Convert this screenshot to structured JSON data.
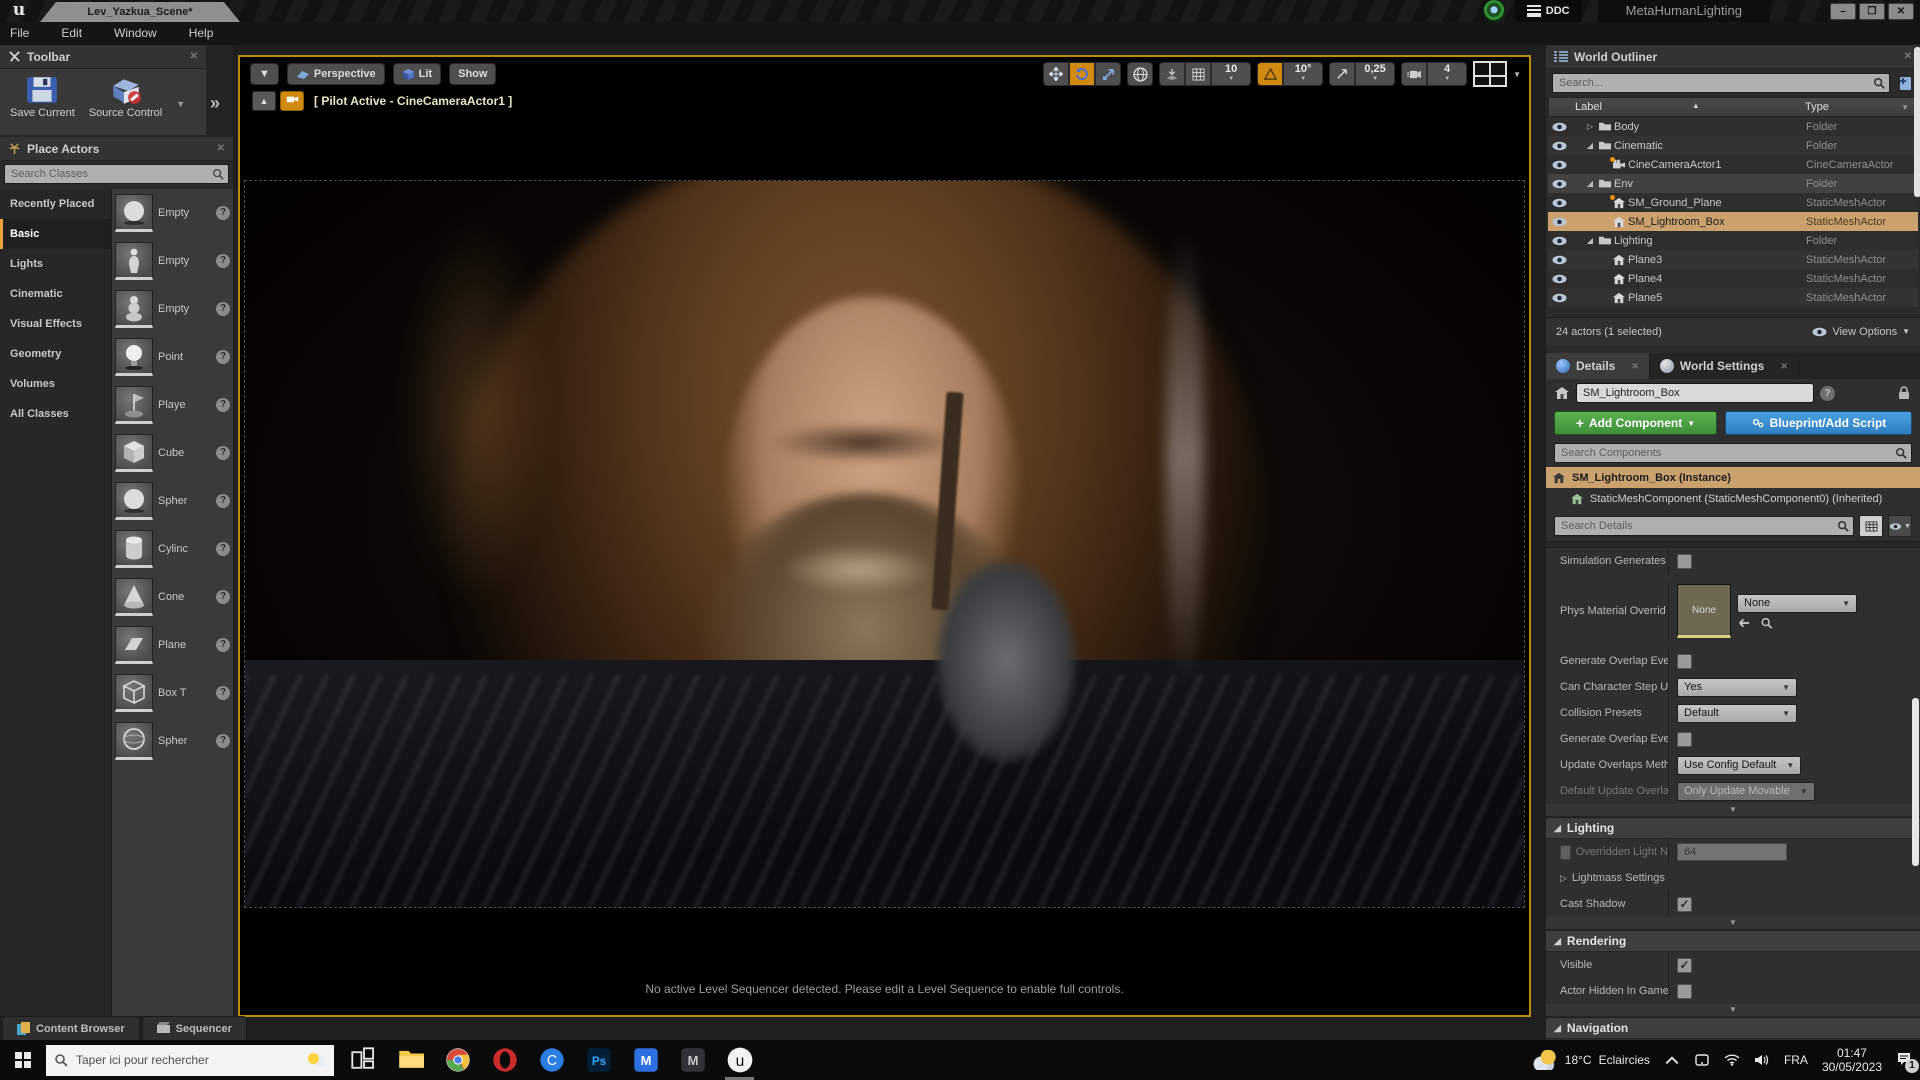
{
  "window": {
    "tab_title": "Lev_Yazkua_Scene*",
    "menu": [
      "File",
      "Edit",
      "Window",
      "Help"
    ],
    "ddc_label": "DDC",
    "session_label": "MetaHumanLighting"
  },
  "icons": {
    "help": "?",
    "sort_asc": "▲",
    "caret": "▼",
    "collapsed": "▷",
    "expanded": "◢",
    "chevrons": "»",
    "minimize": "–",
    "restore": "❐",
    "close": "✕",
    "eject": "▲"
  },
  "toolbar": {
    "title": "Toolbar",
    "save": "Save Current",
    "source": "Source Control"
  },
  "place_actors": {
    "title": "Place Actors",
    "search_placeholder": "Search Classes",
    "categories": [
      {
        "label": "Recently Placed"
      },
      {
        "label": "Basic",
        "selected": true
      },
      {
        "label": "Lights"
      },
      {
        "label": "Cinematic"
      },
      {
        "label": "Visual Effects"
      },
      {
        "label": "Geometry"
      },
      {
        "label": "Volumes"
      },
      {
        "label": "All Classes"
      }
    ],
    "items": [
      {
        "icon": "sphere",
        "label": "Empty"
      },
      {
        "icon": "character",
        "label": "Empty"
      },
      {
        "icon": "pawn",
        "label": "Empty"
      },
      {
        "icon": "point-light",
        "label": "Point"
      },
      {
        "icon": "player-start",
        "label": "Playe"
      },
      {
        "icon": "cube",
        "label": "Cube"
      },
      {
        "icon": "sphere",
        "label": "Spher"
      },
      {
        "icon": "cylinder",
        "label": "Cylinc"
      },
      {
        "icon": "cone",
        "label": "Cone"
      },
      {
        "icon": "plane",
        "label": "Plane"
      },
      {
        "icon": "box-trigger",
        "label": "Box T"
      },
      {
        "icon": "sphere-trigger",
        "label": "Spher"
      }
    ]
  },
  "viewport": {
    "perspective": "Perspective",
    "lit": "Lit",
    "show": "Show",
    "pilot": "[ Pilot Active - CineCameraActor1 ]",
    "snap_move": "10",
    "snap_rotate": "10°",
    "snap_scale": "0,25",
    "camera_speed": "4",
    "message": "No active Level Sequencer detected. Please edit a Level Sequence to enable full controls."
  },
  "outliner": {
    "title": "World Outliner",
    "search_placeholder": "Search...",
    "col_label": "Label",
    "col_type": "Type",
    "rows": [
      {
        "indent": 1,
        "exp": "collapsed",
        "icon": "folder",
        "label": "Body",
        "type": "Folder"
      },
      {
        "indent": 1,
        "exp": "expanded",
        "icon": "folder",
        "label": "Cinematic",
        "type": "Folder"
      },
      {
        "indent": 2,
        "icon": "cine-camera",
        "label": "CineCameraActor1",
        "type": "CineCameraActor",
        "dot": true
      },
      {
        "indent": 1,
        "exp": "expanded",
        "icon": "folder",
        "label": "Env",
        "type": "Folder",
        "hover": true
      },
      {
        "indent": 2,
        "icon": "static-mesh",
        "label": "SM_Ground_Plane",
        "type": "StaticMeshActor",
        "dot": true
      },
      {
        "indent": 2,
        "icon": "static-mesh",
        "label": "SM_Lightroom_Box",
        "type": "StaticMeshActor",
        "selected": true
      },
      {
        "indent": 1,
        "exp": "expanded",
        "icon": "folder",
        "label": "Lighting",
        "type": "Folder"
      },
      {
        "indent": 2,
        "icon": "static-mesh",
        "label": "Plane3",
        "type": "StaticMeshActor"
      },
      {
        "indent": 2,
        "icon": "static-mesh",
        "label": "Plane4",
        "type": "StaticMeshActor"
      },
      {
        "indent": 2,
        "icon": "static-mesh",
        "label": "Plane5",
        "type": "StaticMeshActor"
      }
    ],
    "footer": "24 actors (1 selected)",
    "view_options": "View Options"
  },
  "details": {
    "tab_details": "Details",
    "tab_world": "World Settings",
    "name_value": "SM_Lightroom_Box",
    "add_component": "Add Component",
    "blueprint": "Blueprint/Add Script",
    "search_components": "Search Components",
    "components": [
      "SM_Lightroom_Box (Instance)",
      "StaticMeshComponent (StaticMeshComponent0) (Inherited)"
    ],
    "search_details": "Search Details",
    "rows": [
      {
        "label": "Simulation Generates",
        "control": "checkbox",
        "checked": false
      },
      {
        "label": "Phys Material Overrid",
        "control": "asset",
        "value": "None"
      },
      {
        "label": "Generate Overlap Eve",
        "control": "checkbox",
        "checked": false
      },
      {
        "label": "Can Character Step U",
        "control": "dropdown",
        "value": "Yes"
      },
      {
        "label": "Collision Presets",
        "control": "dropdown",
        "value": "Default"
      },
      {
        "label": "Generate Overlap Eve",
        "control": "checkbox",
        "checked": false
      },
      {
        "label": "Update Overlaps Meth",
        "control": "dropdown",
        "value": "Use Config Default"
      },
      {
        "label": "Default Update Overla",
        "control": "dropdown",
        "value": "Only Update Movable",
        "disabled": true
      }
    ],
    "sections": [
      {
        "title": "Lighting",
        "rows": [
          {
            "label": "Overridden Light N",
            "control": "disabled-input",
            "value": "64"
          },
          {
            "label": "Lightmass Settings",
            "control": "expand-label"
          },
          {
            "label": "Cast Shadow",
            "control": "checkbox",
            "checked": true
          }
        ]
      },
      {
        "title": "Rendering",
        "rows": [
          {
            "label": "Visible",
            "control": "checkbox",
            "checked": true
          },
          {
            "label": "Actor Hidden In Game",
            "control": "checkbox",
            "checked": false
          }
        ]
      },
      {
        "title": "Navigation",
        "rows": []
      }
    ]
  },
  "bottom_tabs": [
    {
      "icon": "content-browser",
      "label": "Content Browser"
    },
    {
      "icon": "sequencer",
      "label": "Sequencer"
    }
  ],
  "taskbar": {
    "search_placeholder": "Taper ici pour rechercher",
    "apps": [
      {
        "icon": "task-view"
      },
      {
        "icon": "file-explorer"
      },
      {
        "icon": "chrome"
      },
      {
        "icon": "opera"
      },
      {
        "icon": "circle-app"
      },
      {
        "icon": "photoshop"
      },
      {
        "icon": "m-blue"
      },
      {
        "icon": "m-dark"
      },
      {
        "icon": "unreal",
        "active": true
      }
    ],
    "weather_temp": "18°C",
    "weather_desc": "Eclaircies",
    "lang": "FRA",
    "time": "01:47",
    "date": "30/05/2023",
    "badge": "1"
  }
}
